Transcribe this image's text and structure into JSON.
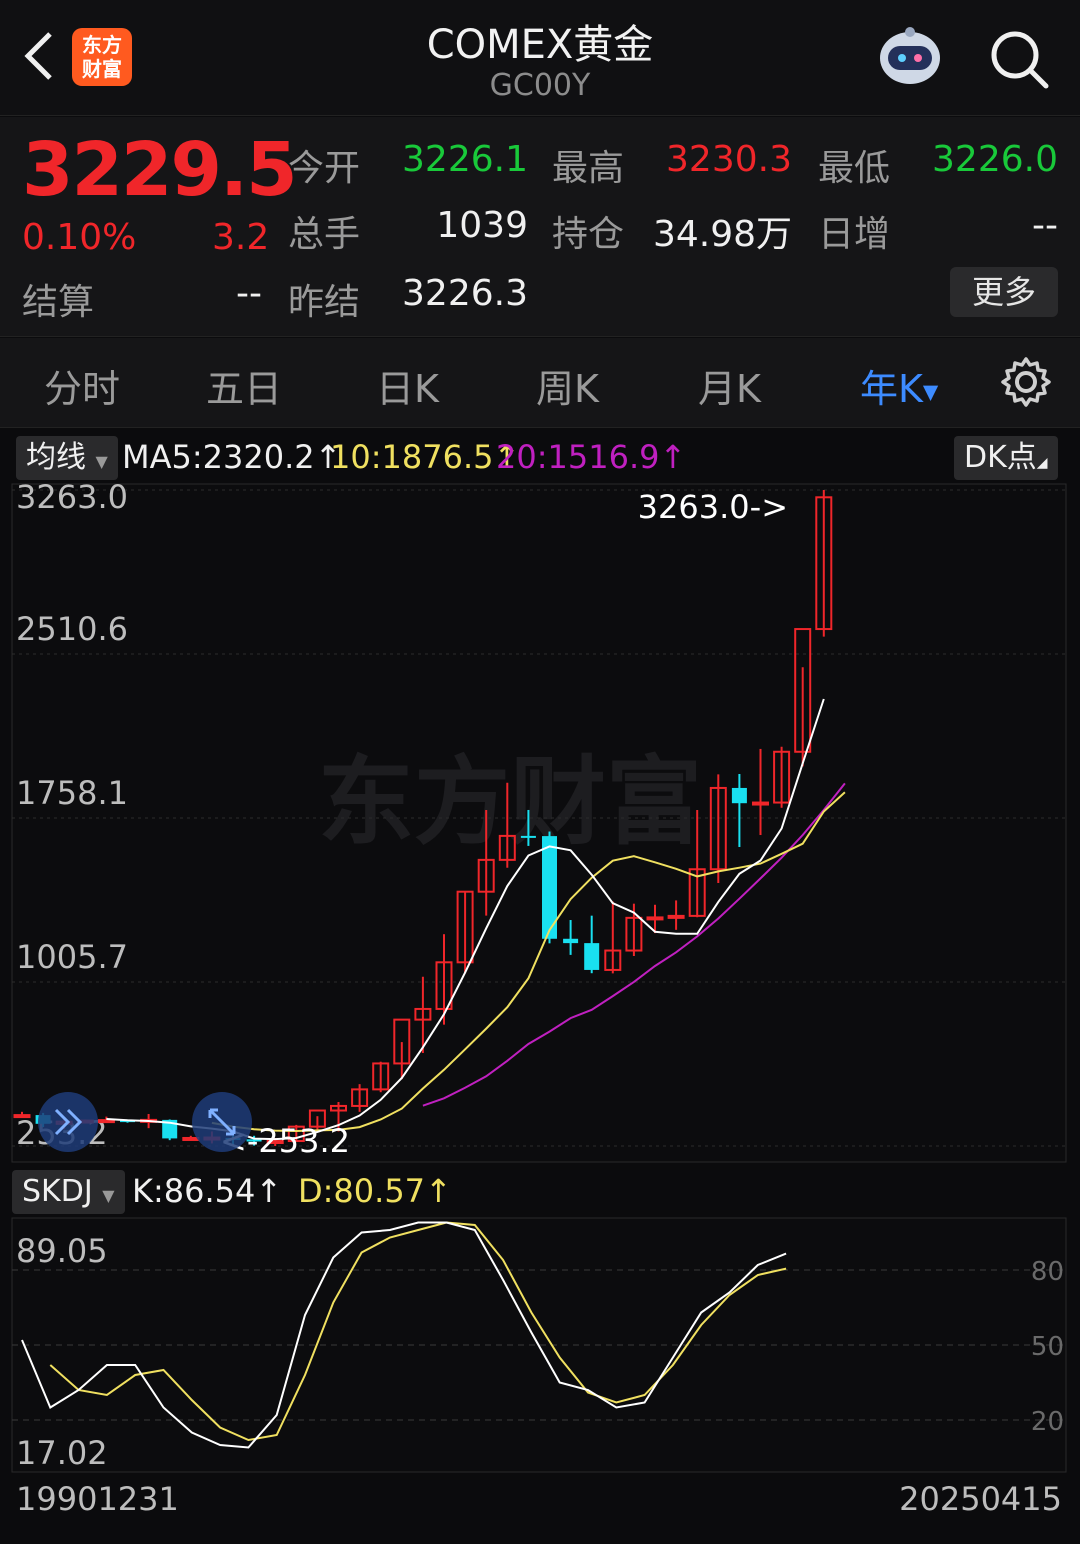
{
  "header": {
    "title": "COMEX黄金",
    "code": "GC00Y",
    "logo_text_line1": "东方",
    "logo_text_line2": "财富"
  },
  "quote": {
    "price": "3229.5",
    "change_pct": "0.10%",
    "change": "3.2",
    "settle_label": "结算",
    "settle_value": "--",
    "open_label": "今开",
    "open_value": "3226.1",
    "high_label": "最高",
    "high_value": "3230.3",
    "low_label": "最低",
    "low_value": "3226.0",
    "volume_label": "总手",
    "volume_value": "1039",
    "oi_label": "持仓",
    "oi_value": "34.98万",
    "daily_inc_label": "日增",
    "daily_inc_value": "--",
    "prev_settle_label": "昨结",
    "prev_settle_value": "3226.3",
    "more_label": "更多"
  },
  "tabs": [
    {
      "label": "分时",
      "active": false
    },
    {
      "label": "五日",
      "active": false
    },
    {
      "label": "日K",
      "active": false
    },
    {
      "label": "周K",
      "active": false
    },
    {
      "label": "月K",
      "active": false
    },
    {
      "label": "年K",
      "active": true
    }
  ],
  "indicators": {
    "ma_selector": "均线",
    "ma5": "MA5:2320.2",
    "ma10": "10:1876.5",
    "ma20": "20:1516.9",
    "dk_label": "DK点",
    "skdj_selector": "SKDJ",
    "k": "K:86.54",
    "d": "D:80.57"
  },
  "colors": {
    "up": "#f0262a",
    "down": "#19e0f0",
    "ma5": "#ffffff",
    "ma10": "#f0e060",
    "ma20": "#c020c0",
    "active_tab": "#3d8bff"
  },
  "chart_data": {
    "type": "candlestick",
    "price_axis_labels": [
      "3263.0",
      "2510.6",
      "1758.1",
      "1005.7",
      "253.2"
    ],
    "ylim": [
      253.2,
      3263.0
    ],
    "max_marker": "3263.0->",
    "min_marker": "<-253.2",
    "x_start_label": "19901231",
    "x_end_label": "20250415",
    "candles": [
      {
        "o": 392,
        "h": 410,
        "l": 385,
        "c": 395
      },
      {
        "o": 395,
        "h": 405,
        "l": 340,
        "c": 355
      },
      {
        "o": 355,
        "h": 380,
        "l": 330,
        "c": 365
      },
      {
        "o": 365,
        "h": 375,
        "l": 360,
        "c": 370
      },
      {
        "o": 370,
        "h": 388,
        "l": 360,
        "c": 372
      },
      {
        "o": 372,
        "h": 375,
        "l": 360,
        "c": 364
      },
      {
        "o": 364,
        "h": 400,
        "l": 335,
        "c": 373
      },
      {
        "o": 373,
        "h": 375,
        "l": 280,
        "c": 288
      },
      {
        "o": 288,
        "h": 300,
        "l": 280,
        "c": 290
      },
      {
        "o": 290,
        "h": 320,
        "l": 265,
        "c": 292
      },
      {
        "o": 290,
        "h": 300,
        "l": 260,
        "c": 284
      },
      {
        "o": 284,
        "h": 300,
        "l": 255,
        "c": 274
      },
      {
        "o": 274,
        "h": 290,
        "l": 253,
        "c": 276
      },
      {
        "o": 276,
        "h": 350,
        "l": 275,
        "c": 342
      },
      {
        "o": 342,
        "h": 390,
        "l": 318,
        "c": 416
      },
      {
        "o": 416,
        "h": 455,
        "l": 320,
        "c": 437
      },
      {
        "o": 437,
        "h": 537,
        "l": 410,
        "c": 513
      },
      {
        "o": 513,
        "h": 640,
        "l": 500,
        "c": 632
      },
      {
        "o": 632,
        "h": 730,
        "l": 560,
        "c": 833
      },
      {
        "o": 833,
        "h": 1030,
        "l": 680,
        "c": 882
      },
      {
        "o": 882,
        "h": 1225,
        "l": 810,
        "c": 1096
      },
      {
        "o": 1096,
        "h": 1420,
        "l": 1045,
        "c": 1420
      },
      {
        "o": 1420,
        "h": 1795,
        "l": 1310,
        "c": 1566
      },
      {
        "o": 1566,
        "h": 1920,
        "l": 1530,
        "c": 1676
      },
      {
        "o": 1676,
        "h": 1795,
        "l": 1630,
        "c": 1675
      },
      {
        "o": 1675,
        "h": 1696,
        "l": 1183,
        "c": 1204
      },
      {
        "o": 1204,
        "h": 1290,
        "l": 1130,
        "c": 1184
      },
      {
        "o": 1184,
        "h": 1310,
        "l": 1046,
        "c": 1061
      },
      {
        "o": 1061,
        "h": 1375,
        "l": 1045,
        "c": 1150
      },
      {
        "o": 1150,
        "h": 1365,
        "l": 1125,
        "c": 1300
      },
      {
        "o": 1300,
        "h": 1360,
        "l": 1230,
        "c": 1302
      },
      {
        "o": 1302,
        "h": 1380,
        "l": 1245,
        "c": 1309
      },
      {
        "o": 1309,
        "h": 1795,
        "l": 1303,
        "c": 1523
      },
      {
        "o": 1523,
        "h": 1958,
        "l": 1460,
        "c": 1896
      },
      {
        "o": 1896,
        "h": 1960,
        "l": 1625,
        "c": 1826
      },
      {
        "o": 1826,
        "h": 2075,
        "l": 1680,
        "c": 1829
      },
      {
        "o": 1829,
        "h": 2085,
        "l": 1805,
        "c": 2062
      },
      {
        "o": 2062,
        "h": 2450,
        "l": 1995,
        "c": 2625
      },
      {
        "o": 2625,
        "h": 3263,
        "l": 2590,
        "c": 3229.5
      }
    ],
    "ma5": [
      null,
      null,
      null,
      null,
      377,
      371,
      368,
      360,
      343,
      333,
      320,
      287,
      285,
      290,
      318,
      349,
      393,
      465,
      565,
      706,
      858,
      1049,
      1252,
      1446,
      1586,
      1628,
      1610,
      1498,
      1367,
      1324,
      1236,
      1227,
      1227,
      1373,
      1502,
      1563,
      1710,
      2009,
      2304
    ],
    "ma10": [
      null,
      null,
      null,
      null,
      null,
      null,
      null,
      null,
      null,
      359,
      342,
      330,
      324,
      322,
      325,
      327,
      340,
      375,
      425,
      517,
      603,
      697,
      792,
      890,
      1022,
      1244,
      1386,
      1484,
      1562,
      1583,
      1555,
      1525,
      1490,
      1513,
      1530,
      1549,
      1594,
      1640,
      1788,
      1876
    ],
    "ma20": [
      null,
      null,
      null,
      null,
      null,
      null,
      null,
      null,
      null,
      null,
      null,
      null,
      null,
      null,
      null,
      null,
      null,
      null,
      null,
      438,
      472,
      520,
      573,
      644,
      721,
      778,
      840,
      878,
      941,
      1006,
      1079,
      1142,
      1215,
      1297,
      1388,
      1481,
      1576,
      1680,
      1795,
      1917
    ],
    "skdj": {
      "ylim": [
        0,
        100
      ],
      "right_ticks": [
        "80",
        "50",
        "20"
      ],
      "left_labels": [
        "89.05",
        "17.02"
      ],
      "k": [
        52,
        25,
        32,
        42,
        42,
        25,
        15,
        10,
        9,
        22,
        62,
        85,
        95,
        96,
        99,
        99,
        96,
        76,
        55,
        35,
        32,
        25,
        27,
        45,
        63,
        71,
        82,
        86.54
      ],
      "d": [
        null,
        42,
        32,
        30,
        38,
        40,
        28,
        17,
        12,
        14,
        38,
        67,
        87,
        93,
        96,
        99,
        98,
        84,
        63,
        45,
        31,
        27,
        30,
        42,
        58,
        70,
        78,
        80.57
      ]
    }
  }
}
